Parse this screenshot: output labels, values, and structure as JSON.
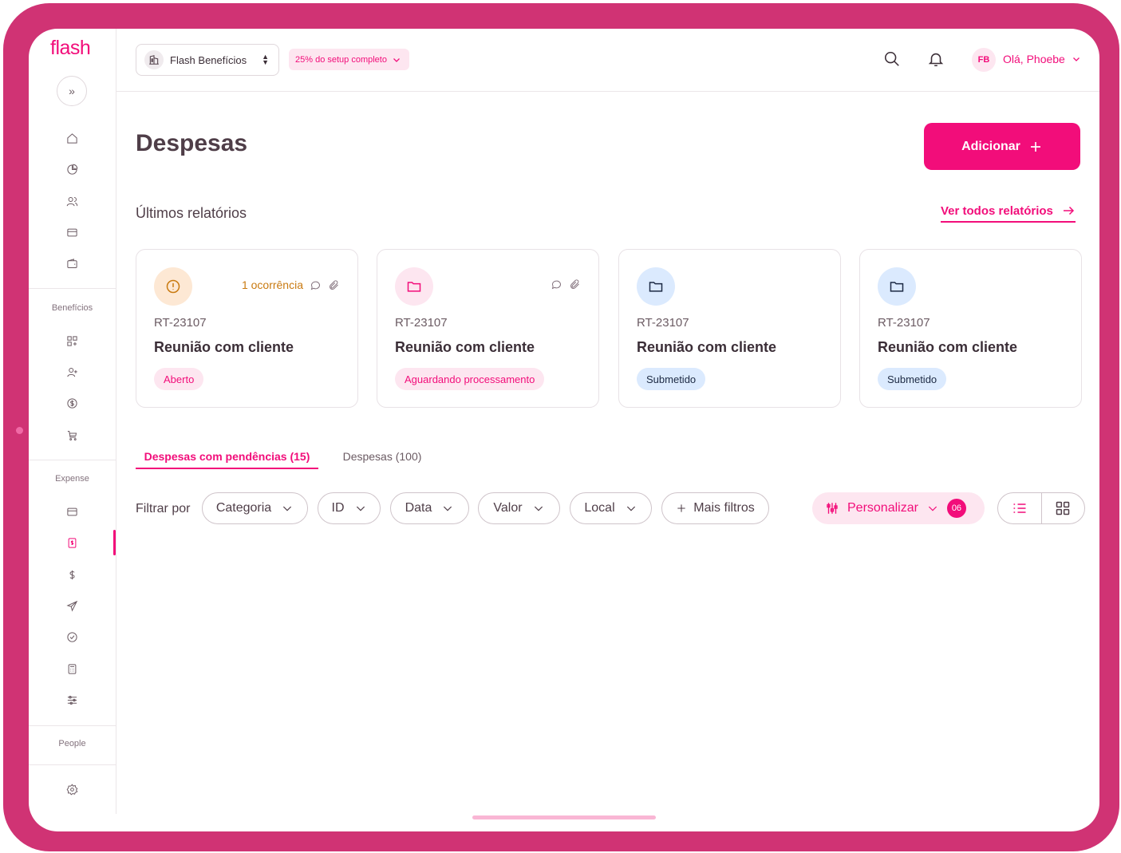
{
  "app": {
    "logo": "flash"
  },
  "sidebar": {
    "sections": [
      "Benefícios",
      "Expense",
      "People"
    ]
  },
  "header": {
    "company": "Flash Benefícios",
    "setup": "25% do setup completo",
    "avatar_initials": "FB",
    "greeting": "Olá, Phoebe"
  },
  "page": {
    "title": "Despesas",
    "add_label": "Adicionar",
    "reports_title": "Últimos relatórios",
    "see_all": "Ver todos relatórios"
  },
  "reports": [
    {
      "id": "RT-23107",
      "name": "Reunião com cliente",
      "status": "Aberto",
      "occurrence": "1 ocorrência"
    },
    {
      "id": "RT-23107",
      "name": "Reunião com cliente",
      "status": "Aguardando processamento"
    },
    {
      "id": "RT-23107",
      "name": "Reunião com cliente",
      "status": "Submetido"
    },
    {
      "id": "RT-23107",
      "name": "Reunião com cliente",
      "status": "Submetido"
    }
  ],
  "tabs": [
    "Despesas com pendências (15)",
    "Despesas (100)"
  ],
  "filters": {
    "label": "Filtrar por",
    "chips": [
      "Categoria",
      "ID",
      "Data",
      "Valor",
      "Local"
    ],
    "more": "Mais filtros",
    "customize": "Personalizar",
    "customize_count": "06"
  },
  "colors": {
    "accent": "#f20d7a",
    "frame": "#d03374",
    "warning": "#c97a10",
    "info_bg": "#dbeafe"
  }
}
